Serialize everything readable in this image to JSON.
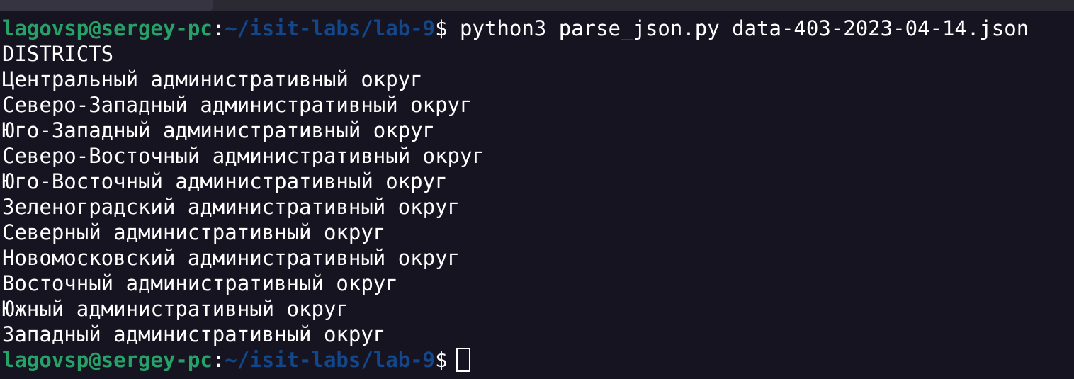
{
  "terminal": {
    "background": "#171421",
    "prompt": {
      "user_host": "lagovsp@sergey-pc",
      "separator": ":",
      "path": "~/isit-labs/lab-9",
      "dollar": "$",
      "user_host_color": "#26a269",
      "path_color": "#12488b"
    },
    "command": " python3 parse_json.py data-403-2023-04-14.json",
    "output_lines": [
      "DISTRICTS",
      "Центральный административный округ",
      "Северо-Западный административный округ",
      "Юго-Западный административный округ",
      "Северо-Восточный административный округ",
      "Юго-Восточный административный округ",
      "Зеленоградский административный округ",
      "Северный административный округ",
      "Новомосковский административный округ",
      "Восточный административный округ",
      "Южный административный округ",
      "Западный административный округ"
    ]
  }
}
